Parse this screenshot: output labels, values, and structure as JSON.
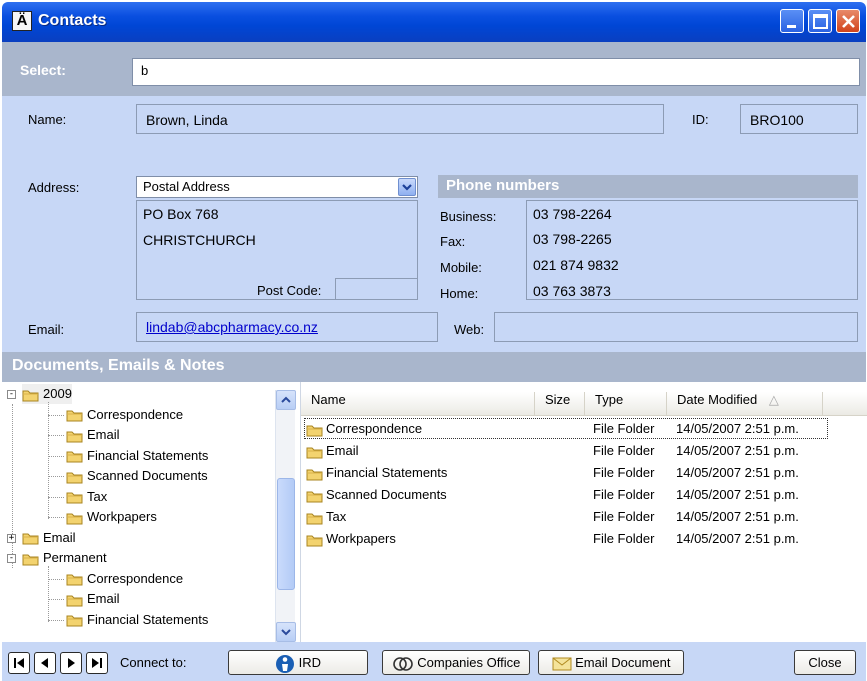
{
  "window": {
    "title": "Contacts",
    "title_icon": "contact-card-icon",
    "controls": [
      "minimize-icon",
      "maximize-icon",
      "close-icon"
    ]
  },
  "select": {
    "label": "Select:",
    "value": "b"
  },
  "contact": {
    "name_label": "Name:",
    "name": "Brown, Linda",
    "id_label": "ID:",
    "id": "BRO100",
    "address_label": "Address:",
    "address_type": "Postal Address",
    "address_lines": [
      "PO Box 768",
      "CHRISTCHURCH"
    ],
    "postcode_label": "Post Code:",
    "postcode": "",
    "email_label": "Email:",
    "email": "lindab@abcpharmacy.co.nz",
    "web_label": "Web:",
    "web": ""
  },
  "phones": {
    "header": "Phone numbers",
    "items": [
      {
        "label": "Business:",
        "value": "03 798-2264"
      },
      {
        "label": "Fax:",
        "value": "03 798-2265"
      },
      {
        "label": "Mobile:",
        "value": "021 874 9832"
      },
      {
        "label": "Home:",
        "value": "03 763 3873"
      }
    ]
  },
  "documents": {
    "header": "Documents, Emails & Notes",
    "tree": [
      {
        "label": "2009",
        "level": 0,
        "expander": "-"
      },
      {
        "label": "Correspondence",
        "level": 1
      },
      {
        "label": "Email",
        "level": 1
      },
      {
        "label": "Financial Statements",
        "level": 1
      },
      {
        "label": "Scanned Documents",
        "level": 1
      },
      {
        "label": "Tax",
        "level": 1
      },
      {
        "label": "Workpapers",
        "level": 1
      },
      {
        "label": "Email",
        "level": 0,
        "expander": "+"
      },
      {
        "label": "Permanent",
        "level": 0,
        "expander": "-"
      },
      {
        "label": "Correspondence",
        "level": 1
      },
      {
        "label": "Email",
        "level": 1
      },
      {
        "label": "Financial Statements",
        "level": 1
      }
    ],
    "columns": {
      "name": "Name",
      "size": "Size",
      "type": "Type",
      "date": "Date Modified"
    },
    "rows": [
      {
        "name": "Correspondence",
        "size": "",
        "type": "File Folder",
        "date": "14/05/2007 2:51 p.m."
      },
      {
        "name": "Email",
        "size": "",
        "type": "File Folder",
        "date": "14/05/2007 2:51 p.m."
      },
      {
        "name": "Financial Statements",
        "size": "",
        "type": "File Folder",
        "date": "14/05/2007 2:51 p.m."
      },
      {
        "name": "Scanned Documents",
        "size": "",
        "type": "File Folder",
        "date": "14/05/2007 2:51 p.m."
      },
      {
        "name": "Tax",
        "size": "",
        "type": "File Folder",
        "date": "14/05/2007 2:51 p.m."
      },
      {
        "name": "Workpapers",
        "size": "",
        "type": "File Folder",
        "date": "14/05/2007 2:51 p.m."
      }
    ]
  },
  "bottom": {
    "nav_icons": [
      "first-record-icon",
      "prev-record-icon",
      "next-record-icon",
      "last-record-icon"
    ],
    "connect_label": "Connect to:",
    "ird": "IRD",
    "companies_office": "Companies Office",
    "email_document": "Email Document",
    "close": "Close"
  },
  "colors": {
    "titlebar": "#0046d5",
    "panel": "#c7d7f6",
    "header_band": "#a9b6cc",
    "link": "#0000cc"
  }
}
